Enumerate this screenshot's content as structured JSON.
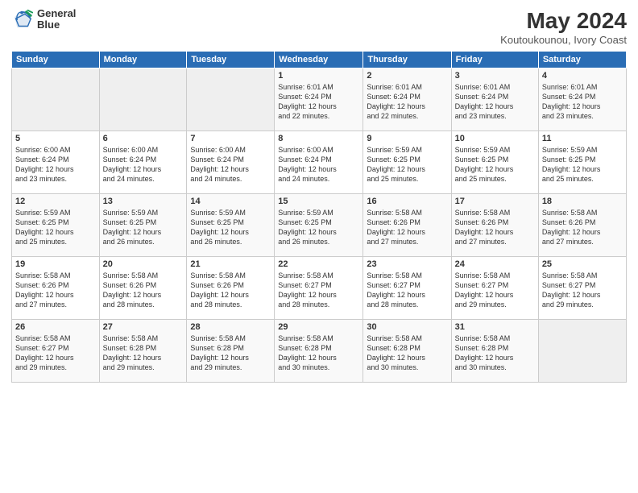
{
  "header": {
    "logo_line1": "General",
    "logo_line2": "Blue",
    "month": "May 2024",
    "location": "Koutoukounou, Ivory Coast"
  },
  "weekdays": [
    "Sunday",
    "Monday",
    "Tuesday",
    "Wednesday",
    "Thursday",
    "Friday",
    "Saturday"
  ],
  "weeks": [
    [
      {
        "day": "",
        "info": ""
      },
      {
        "day": "",
        "info": ""
      },
      {
        "day": "",
        "info": ""
      },
      {
        "day": "1",
        "info": "Sunrise: 6:01 AM\nSunset: 6:24 PM\nDaylight: 12 hours\nand 22 minutes."
      },
      {
        "day": "2",
        "info": "Sunrise: 6:01 AM\nSunset: 6:24 PM\nDaylight: 12 hours\nand 22 minutes."
      },
      {
        "day": "3",
        "info": "Sunrise: 6:01 AM\nSunset: 6:24 PM\nDaylight: 12 hours\nand 23 minutes."
      },
      {
        "day": "4",
        "info": "Sunrise: 6:01 AM\nSunset: 6:24 PM\nDaylight: 12 hours\nand 23 minutes."
      }
    ],
    [
      {
        "day": "5",
        "info": "Sunrise: 6:00 AM\nSunset: 6:24 PM\nDaylight: 12 hours\nand 23 minutes."
      },
      {
        "day": "6",
        "info": "Sunrise: 6:00 AM\nSunset: 6:24 PM\nDaylight: 12 hours\nand 24 minutes."
      },
      {
        "day": "7",
        "info": "Sunrise: 6:00 AM\nSunset: 6:24 PM\nDaylight: 12 hours\nand 24 minutes."
      },
      {
        "day": "8",
        "info": "Sunrise: 6:00 AM\nSunset: 6:24 PM\nDaylight: 12 hours\nand 24 minutes."
      },
      {
        "day": "9",
        "info": "Sunrise: 5:59 AM\nSunset: 6:25 PM\nDaylight: 12 hours\nand 25 minutes."
      },
      {
        "day": "10",
        "info": "Sunrise: 5:59 AM\nSunset: 6:25 PM\nDaylight: 12 hours\nand 25 minutes."
      },
      {
        "day": "11",
        "info": "Sunrise: 5:59 AM\nSunset: 6:25 PM\nDaylight: 12 hours\nand 25 minutes."
      }
    ],
    [
      {
        "day": "12",
        "info": "Sunrise: 5:59 AM\nSunset: 6:25 PM\nDaylight: 12 hours\nand 25 minutes."
      },
      {
        "day": "13",
        "info": "Sunrise: 5:59 AM\nSunset: 6:25 PM\nDaylight: 12 hours\nand 26 minutes."
      },
      {
        "day": "14",
        "info": "Sunrise: 5:59 AM\nSunset: 6:25 PM\nDaylight: 12 hours\nand 26 minutes."
      },
      {
        "day": "15",
        "info": "Sunrise: 5:59 AM\nSunset: 6:25 PM\nDaylight: 12 hours\nand 26 minutes."
      },
      {
        "day": "16",
        "info": "Sunrise: 5:58 AM\nSunset: 6:26 PM\nDaylight: 12 hours\nand 27 minutes."
      },
      {
        "day": "17",
        "info": "Sunrise: 5:58 AM\nSunset: 6:26 PM\nDaylight: 12 hours\nand 27 minutes."
      },
      {
        "day": "18",
        "info": "Sunrise: 5:58 AM\nSunset: 6:26 PM\nDaylight: 12 hours\nand 27 minutes."
      }
    ],
    [
      {
        "day": "19",
        "info": "Sunrise: 5:58 AM\nSunset: 6:26 PM\nDaylight: 12 hours\nand 27 minutes."
      },
      {
        "day": "20",
        "info": "Sunrise: 5:58 AM\nSunset: 6:26 PM\nDaylight: 12 hours\nand 28 minutes."
      },
      {
        "day": "21",
        "info": "Sunrise: 5:58 AM\nSunset: 6:26 PM\nDaylight: 12 hours\nand 28 minutes."
      },
      {
        "day": "22",
        "info": "Sunrise: 5:58 AM\nSunset: 6:27 PM\nDaylight: 12 hours\nand 28 minutes."
      },
      {
        "day": "23",
        "info": "Sunrise: 5:58 AM\nSunset: 6:27 PM\nDaylight: 12 hours\nand 28 minutes."
      },
      {
        "day": "24",
        "info": "Sunrise: 5:58 AM\nSunset: 6:27 PM\nDaylight: 12 hours\nand 29 minutes."
      },
      {
        "day": "25",
        "info": "Sunrise: 5:58 AM\nSunset: 6:27 PM\nDaylight: 12 hours\nand 29 minutes."
      }
    ],
    [
      {
        "day": "26",
        "info": "Sunrise: 5:58 AM\nSunset: 6:27 PM\nDaylight: 12 hours\nand 29 minutes."
      },
      {
        "day": "27",
        "info": "Sunrise: 5:58 AM\nSunset: 6:28 PM\nDaylight: 12 hours\nand 29 minutes."
      },
      {
        "day": "28",
        "info": "Sunrise: 5:58 AM\nSunset: 6:28 PM\nDaylight: 12 hours\nand 29 minutes."
      },
      {
        "day": "29",
        "info": "Sunrise: 5:58 AM\nSunset: 6:28 PM\nDaylight: 12 hours\nand 30 minutes."
      },
      {
        "day": "30",
        "info": "Sunrise: 5:58 AM\nSunset: 6:28 PM\nDaylight: 12 hours\nand 30 minutes."
      },
      {
        "day": "31",
        "info": "Sunrise: 5:58 AM\nSunset: 6:28 PM\nDaylight: 12 hours\nand 30 minutes."
      },
      {
        "day": "",
        "info": ""
      }
    ]
  ]
}
